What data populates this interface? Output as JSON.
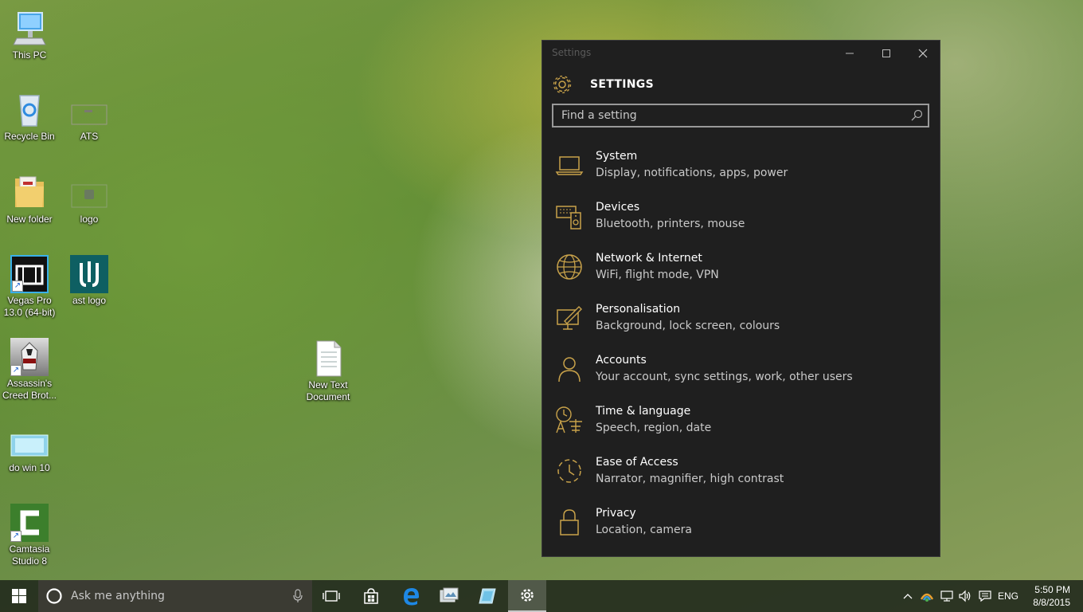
{
  "desktop": {
    "icons": [
      {
        "label": "This PC"
      },
      {
        "label": "Recycle Bin"
      },
      {
        "label": "ATS"
      },
      {
        "label": "New folder"
      },
      {
        "label": "logo"
      },
      {
        "label": "Vegas Pro 13.0 (64-bit)"
      },
      {
        "label": "ast logo"
      },
      {
        "label": "Assassin's Creed Brot..."
      },
      {
        "label": "New Text Document"
      },
      {
        "label": "do win 10"
      },
      {
        "label": "Camtasia Studio 8"
      }
    ]
  },
  "settings": {
    "window_title": "Settings",
    "header": "SETTINGS",
    "search_placeholder": "Find a setting",
    "accent": "#c8a24a",
    "items": [
      {
        "title": "System",
        "subtitle": "Display, notifications, apps, power",
        "icon": "laptop-icon"
      },
      {
        "title": "Devices",
        "subtitle": "Bluetooth, printers, mouse",
        "icon": "devices-icon"
      },
      {
        "title": "Network & Internet",
        "subtitle": "WiFi, flight mode, VPN",
        "icon": "globe-icon"
      },
      {
        "title": "Personalisation",
        "subtitle": "Background, lock screen, colours",
        "icon": "personalisation-icon"
      },
      {
        "title": "Accounts",
        "subtitle": "Your account, sync settings, work, other users",
        "icon": "person-icon"
      },
      {
        "title": "Time & language",
        "subtitle": "Speech, region, date",
        "icon": "time-language-icon"
      },
      {
        "title": "Ease of Access",
        "subtitle": "Narrator, magnifier, high contrast",
        "icon": "ease-of-access-icon"
      },
      {
        "title": "Privacy",
        "subtitle": "Location, camera",
        "icon": "lock-icon"
      }
    ]
  },
  "taskbar": {
    "search_placeholder": "Ask me anything",
    "language": "ENG",
    "time": "5:50 PM",
    "date": "8/8/2015"
  }
}
